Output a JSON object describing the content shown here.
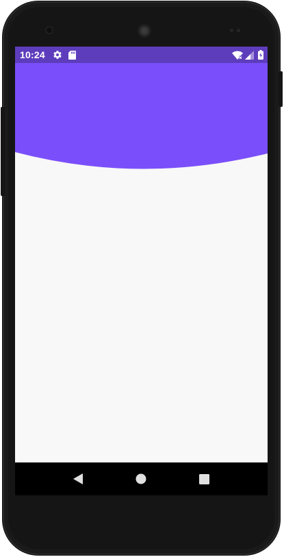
{
  "status_bar": {
    "time": "10:24",
    "left_icons": [
      "gear-icon",
      "sd-card-icon"
    ],
    "right_icons": [
      "wifi-icon",
      "cell-signal-icon",
      "battery-charging-icon"
    ],
    "background_color": "#5e3dbd"
  },
  "header": {
    "accent_color": "#7a4ffb"
  },
  "content": {
    "background_color": "#f8f8f8"
  },
  "navigation_bar": {
    "buttons": [
      "back-icon",
      "home-icon",
      "recents-icon"
    ],
    "background_color": "#000000"
  }
}
